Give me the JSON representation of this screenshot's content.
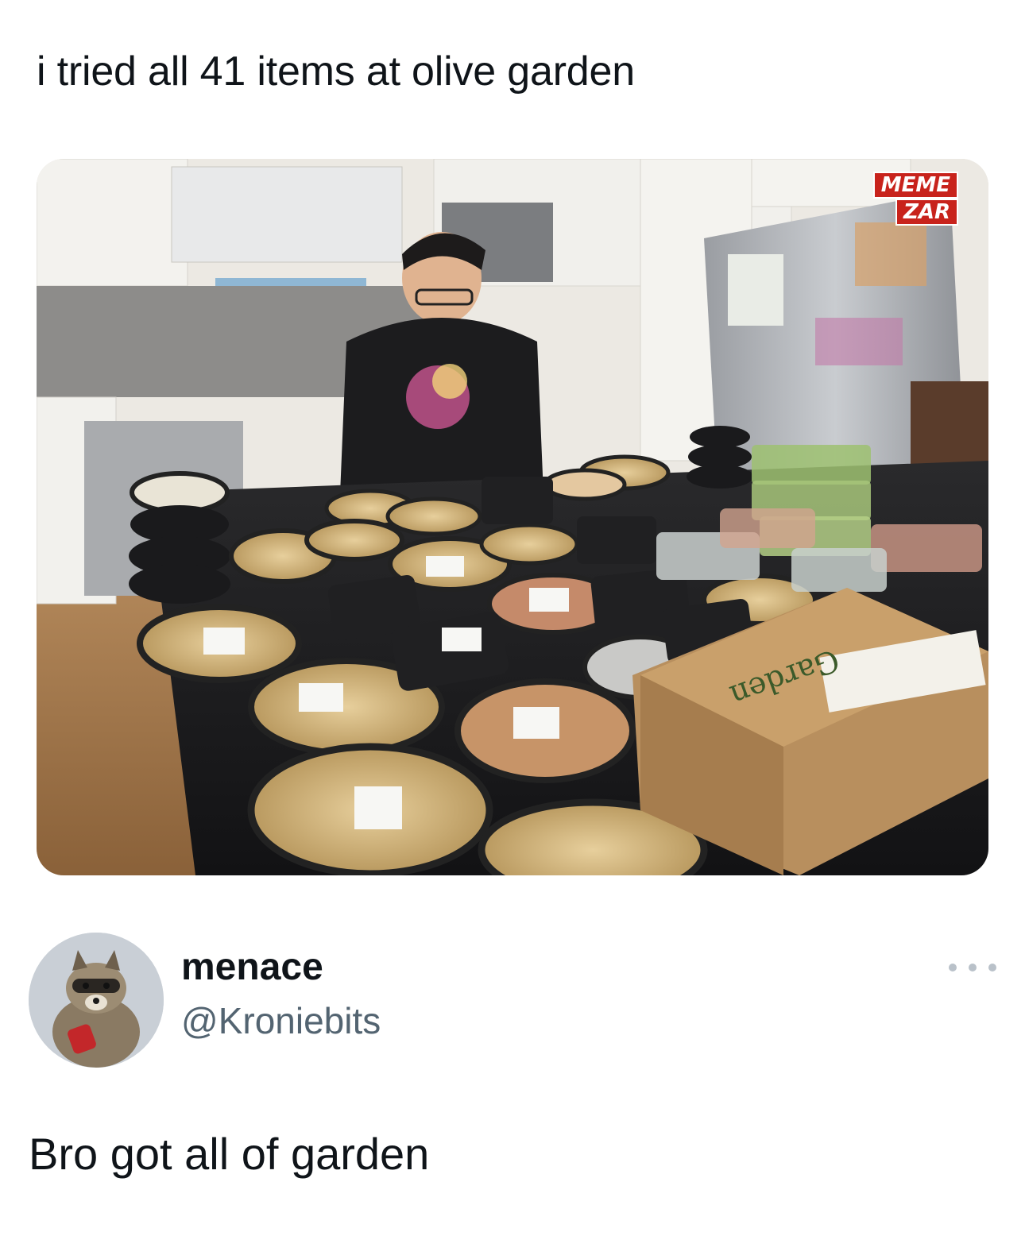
{
  "post": {
    "text": "i tried all 41 items at olive garden"
  },
  "media": {
    "watermark_line1": "MEME",
    "watermark_line2": "ZAR",
    "box_brand": "Garden"
  },
  "quote": {
    "display_name": "menace",
    "handle": "@Kroniebits",
    "avatar_icon": "raccoon-avatar",
    "more_icon": "more-horizontal-icon"
  },
  "reply": {
    "text": "Bro got all of garden"
  },
  "colors": {
    "text_primary": "#0f1419",
    "text_secondary": "#536471",
    "watermark_red": "#c8231c"
  }
}
